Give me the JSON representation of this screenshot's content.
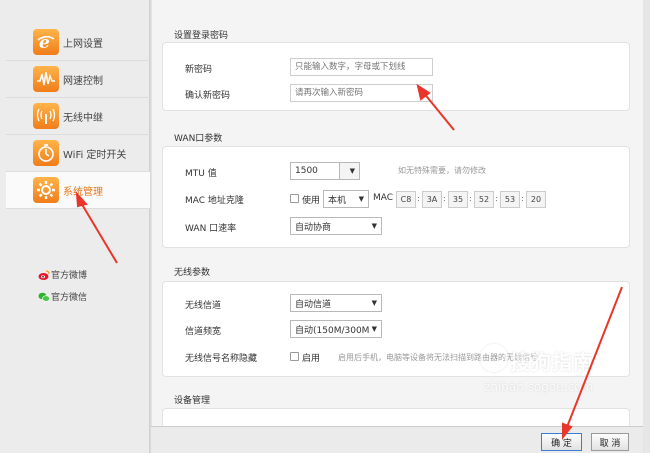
{
  "sidebar": {
    "items": [
      {
        "label": "上网设置",
        "icon": "ie-browser-icon"
      },
      {
        "label": "网速控制",
        "icon": "speed-wave-icon"
      },
      {
        "label": "无线中继",
        "icon": "wireless-tower-icon"
      },
      {
        "label": "WiFi 定时开关",
        "icon": "timer-switch-icon"
      },
      {
        "label": "系统管理",
        "icon": "gear-icon"
      }
    ],
    "active_index": 4,
    "social": [
      {
        "label": "官方微博",
        "icon": "weibo-icon"
      },
      {
        "label": "官方微信",
        "icon": "wechat-icon"
      }
    ]
  },
  "login_password": {
    "title": "设置登录密码",
    "new_password_label": "新密码",
    "new_password_placeholder": "只能输入数字，字母或下划线",
    "confirm_password_label": "确认新密码",
    "confirm_password_placeholder": "请再次输入新密码"
  },
  "wan": {
    "title": "WAN口参数",
    "mtu_label": "MTU 值",
    "mtu_value": "1500",
    "mtu_hint": "如无特殊需要，请勿修改",
    "mac_clone_label": "MAC 地址克隆",
    "mac_use_label": "使用",
    "mac_source": "本机",
    "mac_prefix": "MAC",
    "mac_octets": [
      "C8",
      "3A",
      "35",
      "52",
      "53",
      "20"
    ],
    "mac_separator": ":",
    "rate_label": "WAN 口速率",
    "rate_value": "自动协商"
  },
  "wireless": {
    "title": "无线参数",
    "channel_label": "无线信道",
    "channel_value": "自动信道",
    "bandwidth_label": "信道频宽",
    "bandwidth_value": "自动(150M/300M",
    "hide_ssid_label": "无线信号名称隐藏",
    "hide_ssid_enable": "启用",
    "hide_ssid_hint": "启用后手机，电脑等设备将无法扫描到路由器的无线信号"
  },
  "device": {
    "title": "设备管理"
  },
  "footer": {
    "confirm_label": "确 定",
    "cancel_label": "取 消"
  },
  "watermark": {
    "main": "搜狗指南",
    "sub": "zhinan.sogou.com"
  },
  "colors": {
    "accent": "#e8781a",
    "arrow": "#e8362a",
    "focus": "#3a7bd5"
  }
}
